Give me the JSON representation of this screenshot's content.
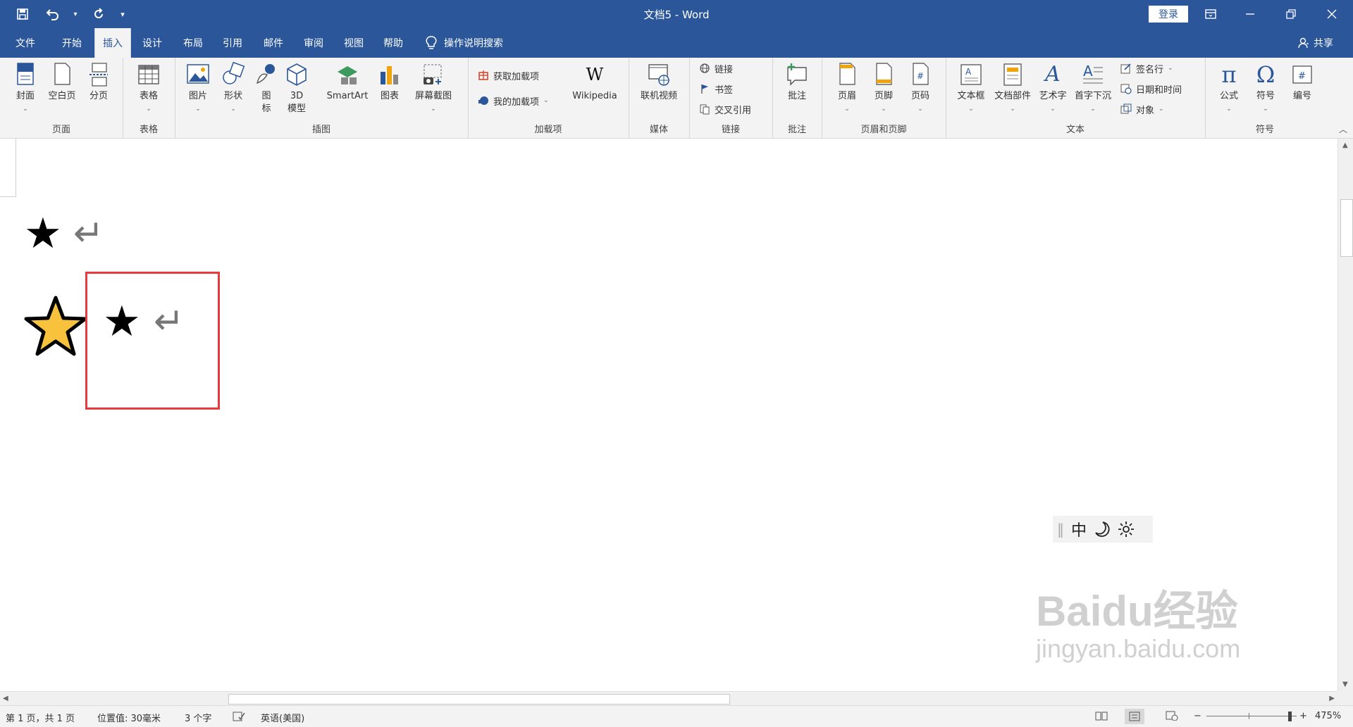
{
  "window": {
    "title": "文档5 - Word",
    "login_label": "登录"
  },
  "tabs": [
    "文件",
    "开始",
    "插入",
    "设计",
    "布局",
    "引用",
    "邮件",
    "审阅",
    "视图",
    "帮助"
  ],
  "active_tab": "插入",
  "tell_me": "操作说明搜索",
  "share_label": "共享",
  "ribbon": {
    "pages": {
      "label": "页面",
      "buttons": [
        "封面",
        "空白页",
        "分页"
      ]
    },
    "tables": {
      "label": "表格",
      "buttons": [
        "表格"
      ]
    },
    "illustrations": {
      "label": "插图",
      "buttons": [
        "图片",
        "形状",
        "图\n标",
        "3D\n模型",
        "SmartArt",
        "图表",
        "屏幕截图"
      ]
    },
    "addins": {
      "label": "加载项",
      "get": "获取加载项",
      "mine": "我的加载项",
      "wiki": "Wikipedia"
    },
    "media": {
      "label": "媒体",
      "buttons": [
        "联机视频"
      ]
    },
    "links": {
      "label": "链接",
      "items": [
        "链接",
        "书签",
        "交叉引用"
      ]
    },
    "comments": {
      "label": "批注",
      "buttons": [
        "批注"
      ]
    },
    "header_footer": {
      "label": "页眉和页脚",
      "buttons": [
        "页眉",
        "页脚",
        "页码"
      ]
    },
    "text": {
      "label": "文本",
      "buttons": [
        "文本框",
        "文档部件",
        "艺术字",
        "首字下沉"
      ],
      "small": [
        "签名行",
        "日期和时间",
        "对象"
      ]
    },
    "symbols": {
      "label": "符号",
      "buttons": [
        "公式",
        "符号",
        "编号"
      ]
    }
  },
  "document": {
    "line1_symbol": "★",
    "line2_symbol": "★",
    "para_mark": "↵"
  },
  "ime": {
    "mode": "中"
  },
  "watermark": {
    "main": "Baidu经验",
    "sub": "jingyan.baidu.com"
  },
  "status": {
    "page": "第 1 页，共 1 页",
    "position": "位置值: 30毫米",
    "words": "3 个字",
    "language": "英语(美国)",
    "zoom": "475%"
  },
  "colors": {
    "brand": "#2b579a",
    "highlight": "#e83b40",
    "star_fill": "#f9c23c"
  }
}
